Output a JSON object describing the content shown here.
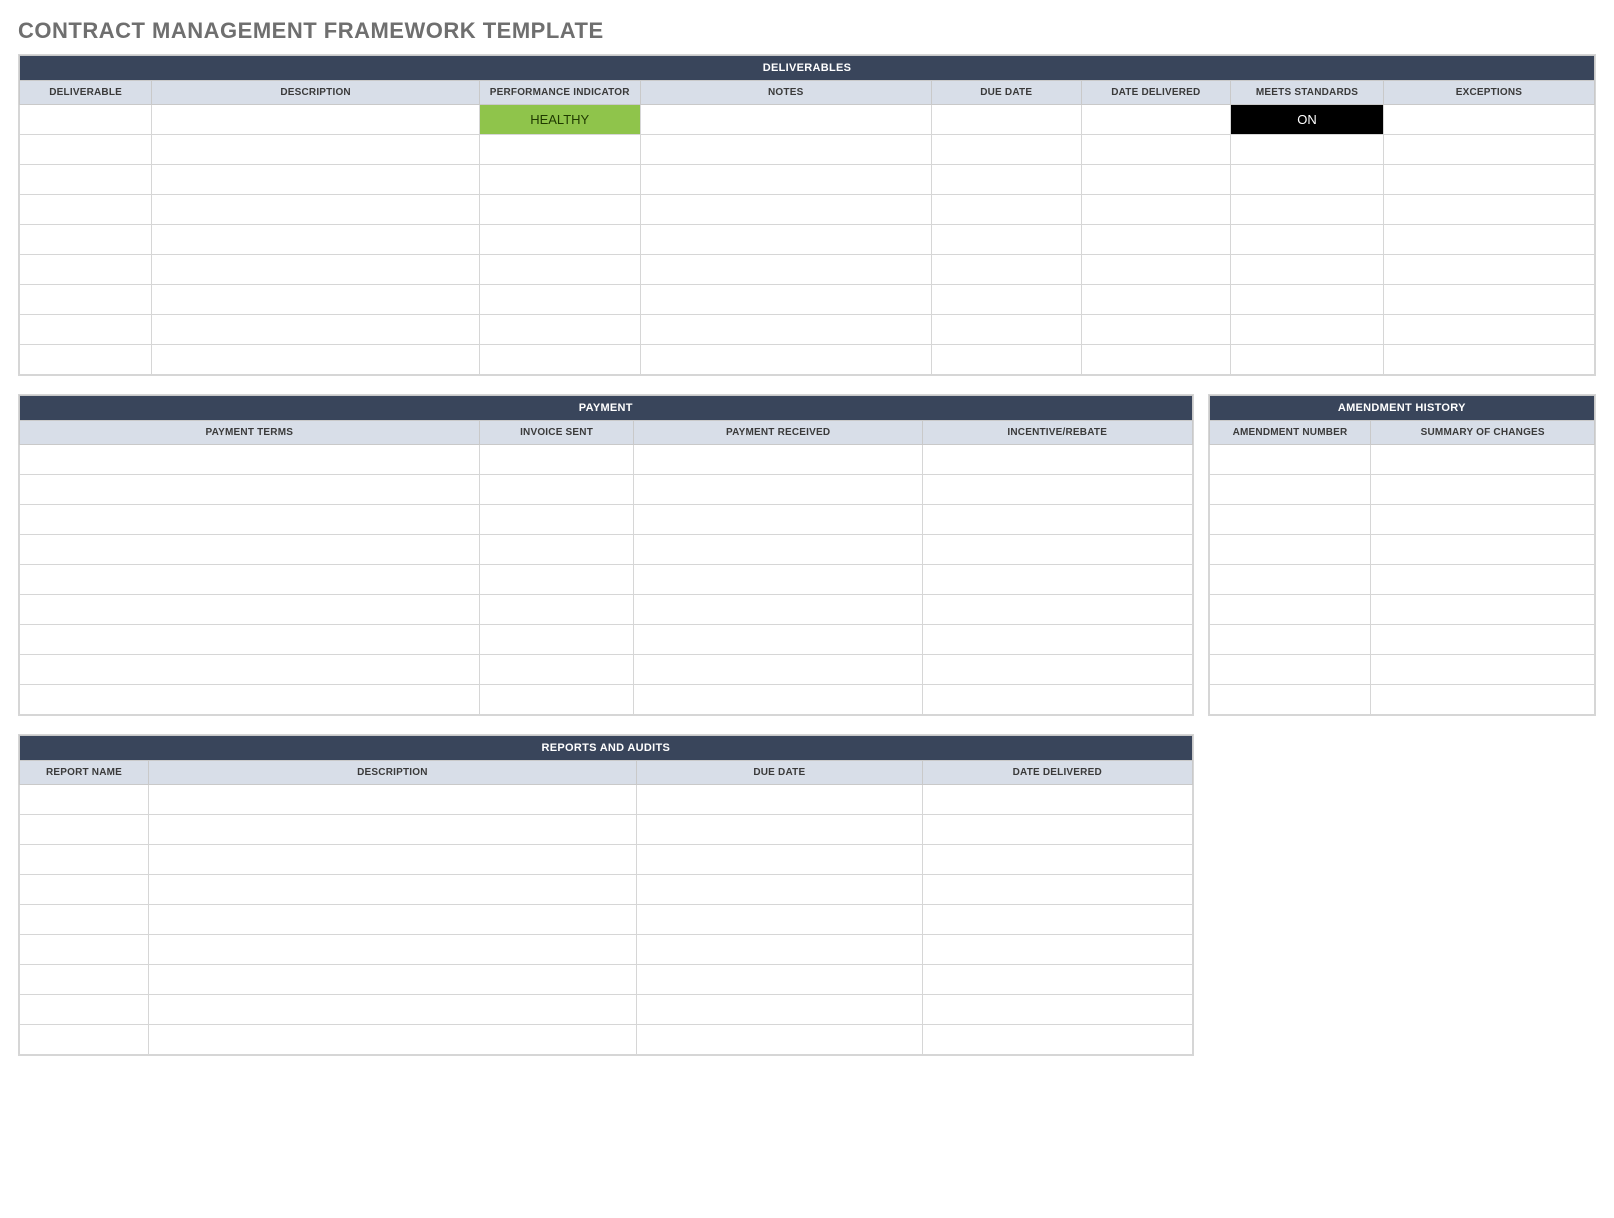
{
  "title": "CONTRACT MANAGEMENT FRAMEWORK TEMPLATE",
  "deliverables": {
    "section_label": "DELIVERABLES",
    "columns": [
      "DELIVERABLE",
      "DESCRIPTION",
      "PERFORMANCE INDICATOR",
      "NOTES",
      "DUE DATE",
      "DATE DELIVERED",
      "MEETS STANDARDS",
      "EXCEPTIONS"
    ],
    "rows": [
      {
        "deliverable": "",
        "description": "",
        "performance": "HEALTHY",
        "notes": "",
        "due": "",
        "delivered": "",
        "meets": "ON",
        "exceptions": ""
      },
      {
        "deliverable": "",
        "description": "",
        "performance": "",
        "notes": "",
        "due": "",
        "delivered": "",
        "meets": "",
        "exceptions": ""
      },
      {
        "deliverable": "",
        "description": "",
        "performance": "",
        "notes": "",
        "due": "",
        "delivered": "",
        "meets": "",
        "exceptions": ""
      },
      {
        "deliverable": "",
        "description": "",
        "performance": "",
        "notes": "",
        "due": "",
        "delivered": "",
        "meets": "",
        "exceptions": ""
      },
      {
        "deliverable": "",
        "description": "",
        "performance": "",
        "notes": "",
        "due": "",
        "delivered": "",
        "meets": "",
        "exceptions": ""
      },
      {
        "deliverable": "",
        "description": "",
        "performance": "",
        "notes": "",
        "due": "",
        "delivered": "",
        "meets": "",
        "exceptions": ""
      },
      {
        "deliverable": "",
        "description": "",
        "performance": "",
        "notes": "",
        "due": "",
        "delivered": "",
        "meets": "",
        "exceptions": ""
      },
      {
        "deliverable": "",
        "description": "",
        "performance": "",
        "notes": "",
        "due": "",
        "delivered": "",
        "meets": "",
        "exceptions": ""
      },
      {
        "deliverable": "",
        "description": "",
        "performance": "",
        "notes": "",
        "due": "",
        "delivered": "",
        "meets": "",
        "exceptions": ""
      }
    ]
  },
  "payment": {
    "section_label": "PAYMENT",
    "columns": [
      "PAYMENT TERMS",
      "INVOICE SENT",
      "PAYMENT RECEIVED",
      "INCENTIVE/REBATE"
    ],
    "row_count": 9
  },
  "amendment": {
    "section_label": "AMENDMENT HISTORY",
    "columns": [
      "AMENDMENT NUMBER",
      "SUMMARY OF CHANGES"
    ],
    "row_count": 9
  },
  "reports": {
    "section_label": "REPORTS AND AUDITS",
    "columns": [
      "REPORT NAME",
      "DESCRIPTION",
      "DUE DATE",
      "DATE DELIVERED"
    ],
    "row_count": 9
  }
}
